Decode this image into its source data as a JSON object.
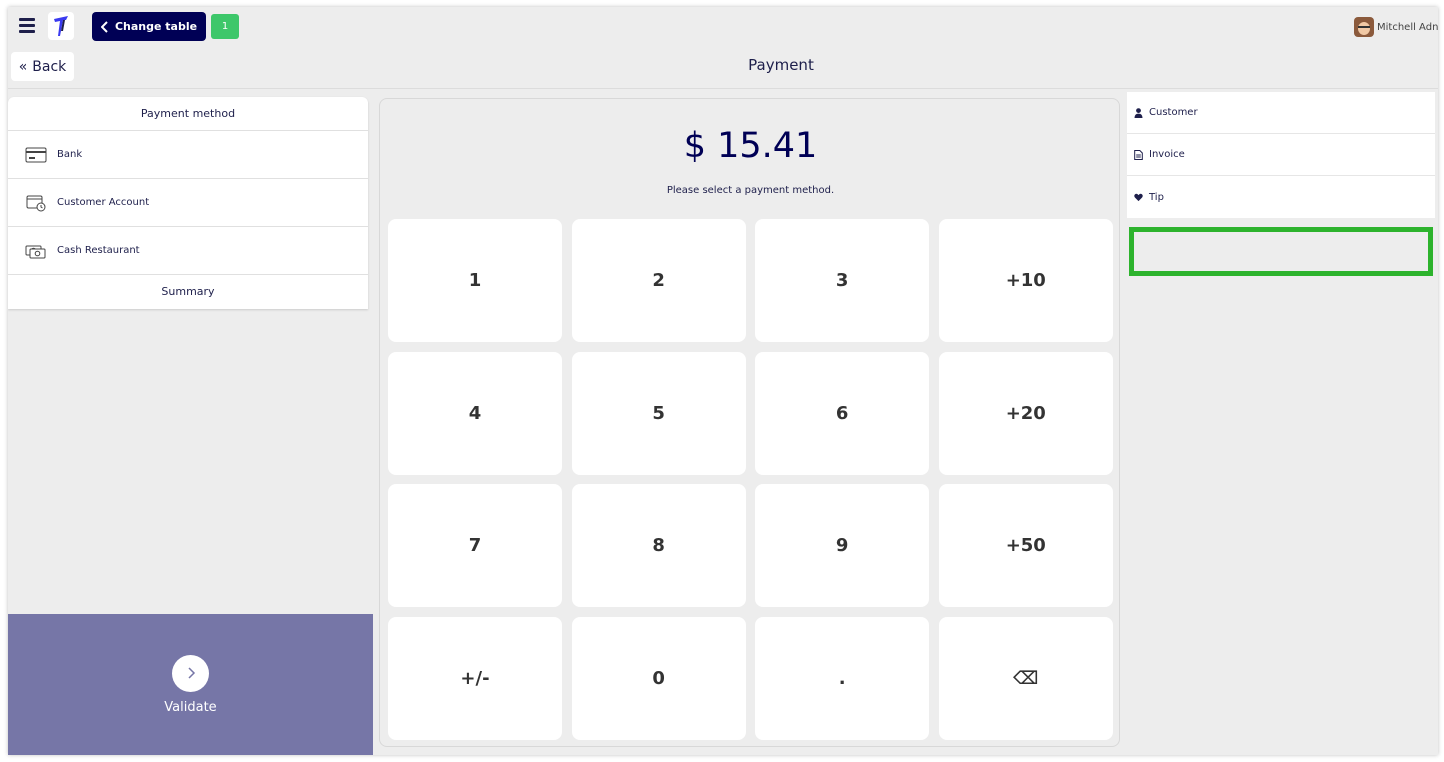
{
  "header": {
    "change_table_label": "Change table",
    "table_count": "1",
    "user_name": "Mitchell Adn",
    "back_label": "Back",
    "page_title": "Payment"
  },
  "payment_methods": {
    "title": "Payment method",
    "items": [
      {
        "label": "Bank",
        "icon": "bank-card-icon"
      },
      {
        "label": "Customer Account",
        "icon": "customer-account-icon"
      },
      {
        "label": "Cash Restaurant",
        "icon": "cash-icon"
      }
    ],
    "summary_label": "Summary"
  },
  "payment": {
    "amount": "$ 15.41",
    "hint": "Please select a payment method."
  },
  "keypad": {
    "keys": [
      "1",
      "2",
      "3",
      "+10",
      "4",
      "5",
      "6",
      "+20",
      "7",
      "8",
      "9",
      "+50",
      "+/-",
      "0",
      ".",
      "⌫"
    ]
  },
  "side_options": [
    {
      "label": "Customer",
      "icon": "user-icon"
    },
    {
      "label": "Invoice",
      "icon": "document-icon"
    },
    {
      "label": "Tip",
      "icon": "heart-icon"
    }
  ],
  "validate": {
    "label": "Validate"
  },
  "colors": {
    "primary": "#000055",
    "badge": "#3dc76a",
    "validate": "#7676a7",
    "highlight": "#2db32d"
  }
}
